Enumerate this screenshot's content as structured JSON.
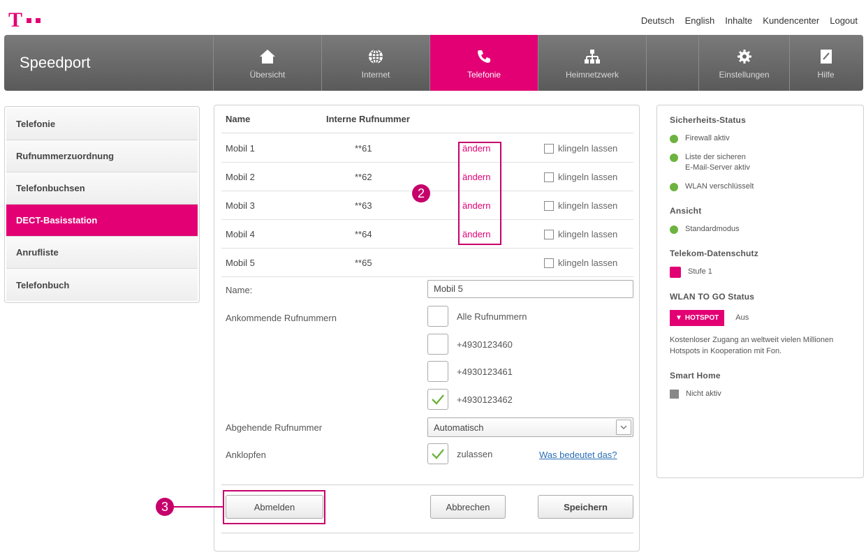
{
  "header": {
    "links": [
      "Deutsch",
      "English",
      "Inhalte",
      "Kundencenter",
      "Logout"
    ]
  },
  "nav": {
    "brand": "Speedport",
    "items": [
      {
        "label": "Übersicht",
        "icon": "home-icon"
      },
      {
        "label": "Internet",
        "icon": "globe-icon"
      },
      {
        "label": "Telefonie",
        "icon": "phone-icon",
        "active": true
      },
      {
        "label": "Heimnetzwerk",
        "icon": "network-icon"
      },
      {
        "label": "Einstellungen",
        "icon": "gear-icon"
      },
      {
        "label": "Hilfe",
        "icon": "help-icon"
      }
    ]
  },
  "sidebar": {
    "items": [
      {
        "label": "Telefonie"
      },
      {
        "label": "Rufnummerzuordnung"
      },
      {
        "label": "Telefonbuchsen"
      },
      {
        "label": "DECT-Basisstation",
        "active": true
      },
      {
        "label": "Anrufliste"
      },
      {
        "label": "Telefonbuch"
      }
    ]
  },
  "table": {
    "col_name": "Name",
    "col_number": "Interne Rufnummer",
    "change_label": "ändern",
    "ring_label": "klingeln lassen",
    "rows": [
      {
        "name": "Mobil 1",
        "number": "**61"
      },
      {
        "name": "Mobil 2",
        "number": "**62"
      },
      {
        "name": "Mobil 3",
        "number": "**63"
      },
      {
        "name": "Mobil 4",
        "number": "**64"
      },
      {
        "name": "Mobil 5",
        "number": "**65"
      }
    ]
  },
  "form": {
    "name_label": "Name:",
    "name_value": "Mobil 5",
    "incoming_label": "Ankommende Rufnummern",
    "incoming_options": [
      {
        "label": "Alle Rufnummern",
        "checked": false
      },
      {
        "label": "+4930123460",
        "checked": false
      },
      {
        "label": "+4930123461",
        "checked": false
      },
      {
        "label": "+4930123462",
        "checked": true
      }
    ],
    "outgoing_label": "Abgehende Rufnummer",
    "outgoing_value": "Automatisch",
    "knock_label": "Anklopfen",
    "knock_option": "zulassen",
    "knock_checked": true,
    "help_link": "Was bedeutet das?"
  },
  "buttons": {
    "logout": "Abmelden",
    "cancel": "Abbrechen",
    "save": "Speichern"
  },
  "callouts": {
    "change_marker": "2",
    "logout_marker": "3"
  },
  "status": {
    "security_title": "Sicherheits-Status",
    "firewall": "Firewall aktiv",
    "mail_line1": "Liste der sicheren",
    "mail_line2": "E-Mail-Server aktiv",
    "wlan": "WLAN verschlüsselt",
    "view_title": "Ansicht",
    "view_value": "Standardmodus",
    "privacy_title": "Telekom-Datenschutz",
    "privacy_value": "Stufe 1",
    "wlan_to_go_title": "WLAN TO GO Status",
    "hotspot_label": "HOTSPOT",
    "hotspot_state": "Aus",
    "hotspot_text": "Kostenloser Zugang an weltweit vielen Millionen Hotspots in Kooperation mit Fon.",
    "smarthome_title": "Smart Home",
    "smarthome_value": "Nicht aktiv"
  },
  "colors": {
    "brand": "#e20074",
    "status_ok": "#6db33f",
    "link": "#2a6fb6"
  }
}
